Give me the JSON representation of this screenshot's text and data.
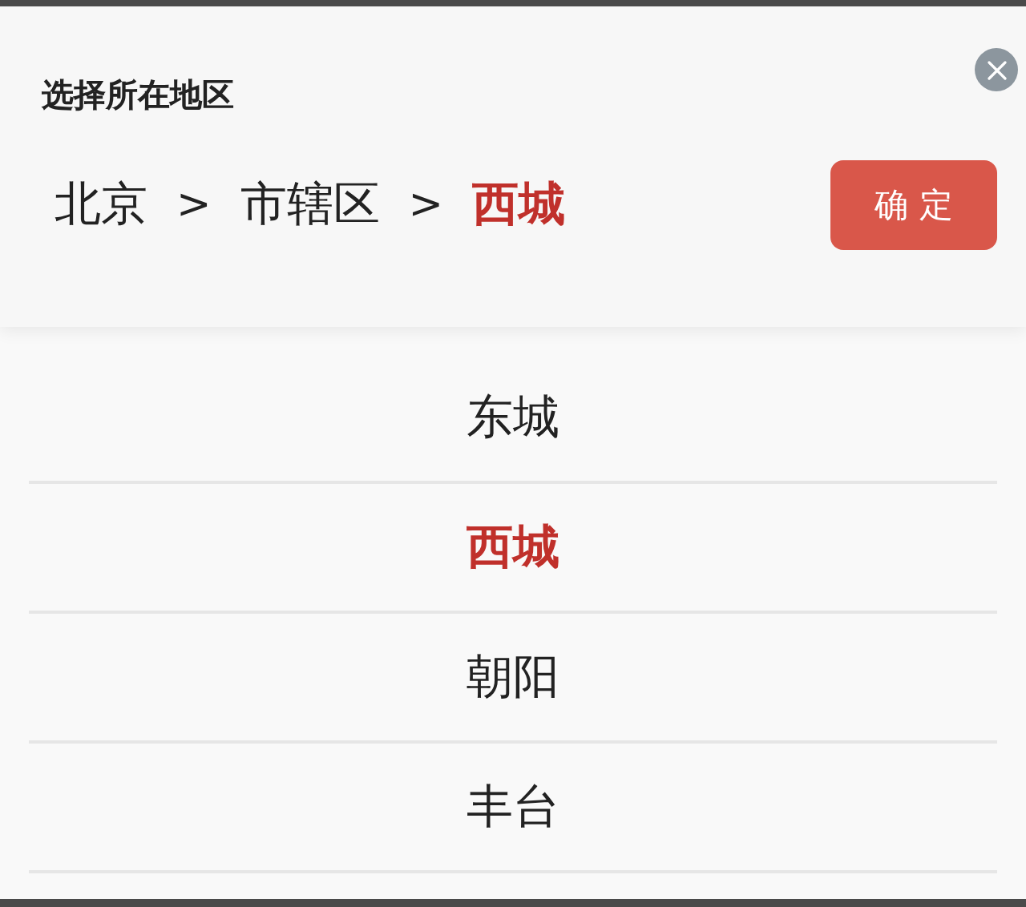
{
  "title": "选择所在地区",
  "path": [
    {
      "kind": "level",
      "label": "北京",
      "selected": false
    },
    {
      "kind": "separator",
      "label": ">"
    },
    {
      "kind": "level",
      "label": "市辖区",
      "selected": false
    },
    {
      "kind": "separator",
      "label": ">"
    },
    {
      "kind": "level",
      "label": "西城",
      "selected": true
    }
  ],
  "confirm_button": "确 定",
  "options": [
    {
      "label": "东城",
      "selected": false
    },
    {
      "label": "西城",
      "selected": true
    },
    {
      "label": "朝阳",
      "selected": false
    },
    {
      "label": "丰台",
      "selected": false
    }
  ]
}
